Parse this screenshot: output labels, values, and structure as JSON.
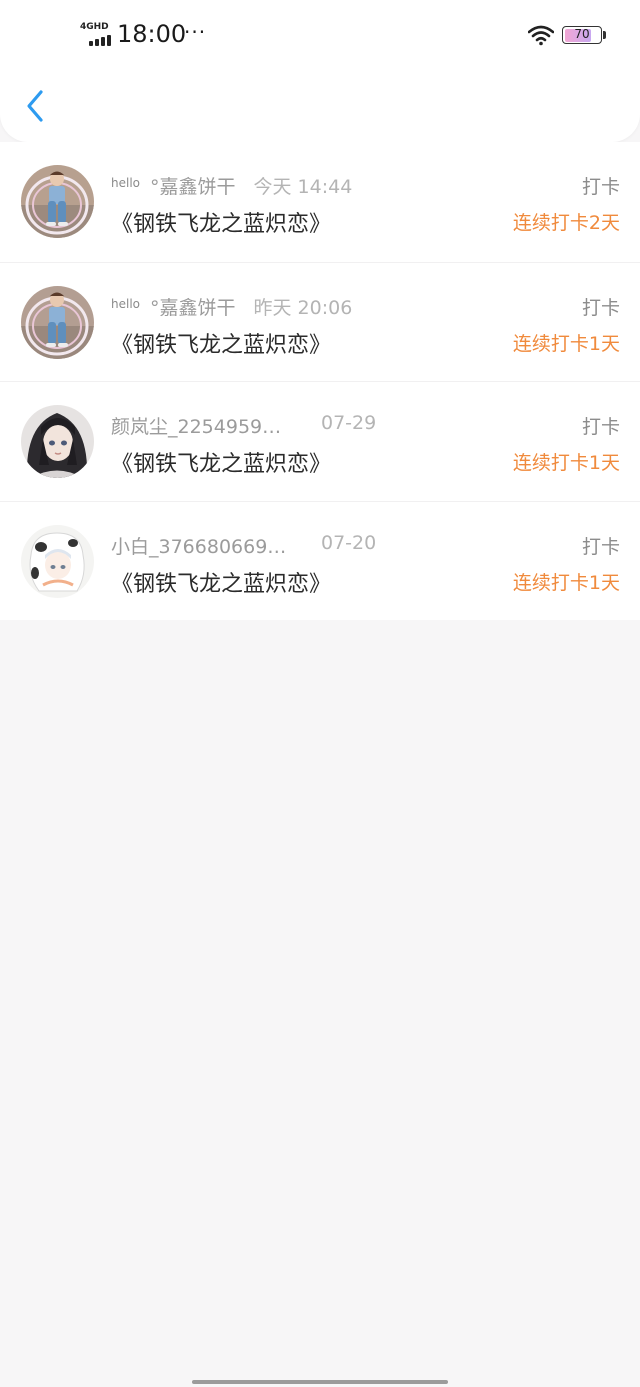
{
  "status_bar": {
    "network": "4GHD",
    "time": "18:00",
    "more": "···",
    "battery_level": "70",
    "battery_fraction": 0.7,
    "wifi_icon": "wifi-icon"
  },
  "header": {
    "back_icon": "chevron-left-icon",
    "accent_color": "#2d9bf0"
  },
  "list": {
    "items": [
      {
        "tag": "hello",
        "name": "°嘉鑫饼干",
        "when": "今天  14:44",
        "title": "《钢铁飞龙之蓝炽恋》",
        "action": "打卡",
        "streak": "连续打卡2天"
      },
      {
        "tag": "hello",
        "name": "°嘉鑫饼干",
        "when": "昨天  20:06",
        "title": "《钢铁飞龙之蓝炽恋》",
        "action": "打卡",
        "streak": "连续打卡1天"
      },
      {
        "tag": "",
        "name": "颜岚尘_2254959…",
        "when": "07-29",
        "title": "《钢铁飞龙之蓝炽恋》",
        "action": "打卡",
        "streak": "连续打卡1天"
      },
      {
        "tag": "",
        "name": "小白_376680669…",
        "when": "07-20",
        "title": "《钢铁飞龙之蓝炽恋》",
        "action": "打卡",
        "streak": "连续打卡1天"
      }
    ]
  },
  "colors": {
    "streak": "#f08a3c",
    "background": "#f7f6f7"
  }
}
